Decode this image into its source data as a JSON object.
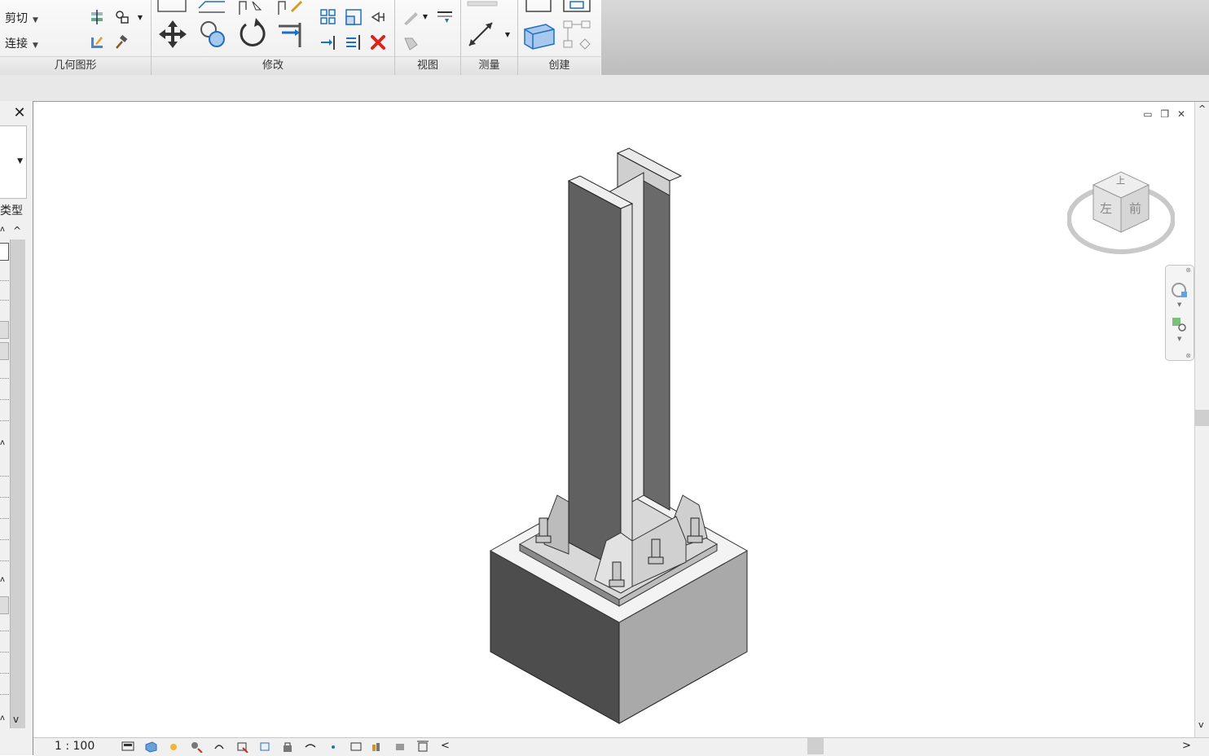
{
  "ribbon": {
    "geometry": {
      "label": "几何图形",
      "cut_label": "剪切",
      "join_label": "连接"
    },
    "modify": {
      "label": "修改"
    },
    "view": {
      "label": "视图"
    },
    "measure": {
      "label": "测量"
    },
    "create": {
      "label": "创建"
    }
  },
  "properties_panel": {
    "type_label": "类型"
  },
  "viewcube": {
    "top_face": "上",
    "left_face": "左",
    "front_face": "前"
  },
  "status_bar": {
    "scale": "1 : 100"
  },
  "colors": {
    "ribbon_bg": "#eeeeee",
    "modify_delete": "#d9261c",
    "accent_blue": "#1f6fc0"
  }
}
